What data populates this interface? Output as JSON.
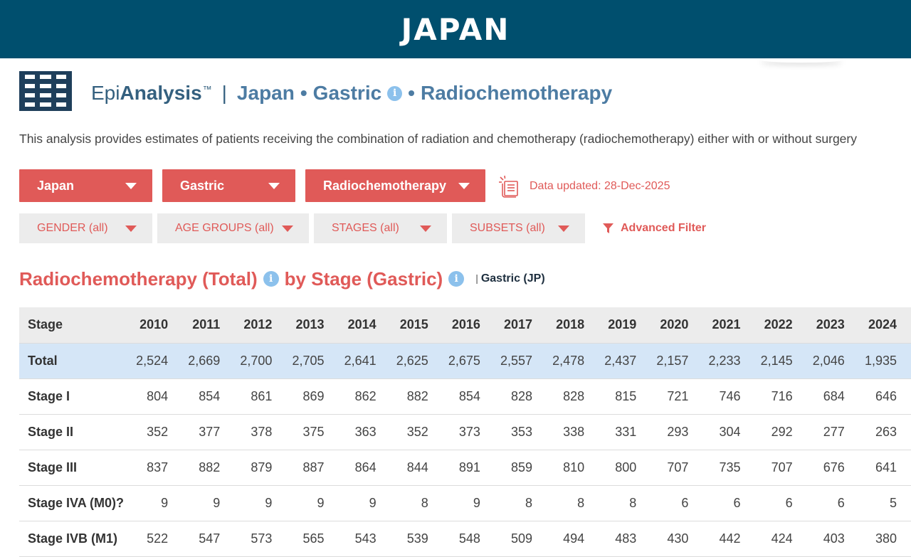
{
  "banner": {
    "title": "JAPAN"
  },
  "header": {
    "brand_light": "Epi",
    "brand_bold": "Analysis",
    "trademark": "™",
    "pipe": "|",
    "crumb_country": "Japan",
    "crumb_cancer": "Gastric",
    "crumb_treatment": "Radiochemotherapy",
    "separator": "•",
    "info_glyph": "i"
  },
  "description": "This analysis provides estimates of patients receiving the combination of radiation and chemotherapy (radiochemotherapy) either with or without surgery",
  "selectors": [
    {
      "label": "Japan"
    },
    {
      "label": "Gastric"
    },
    {
      "label": "Radiochemotherapy"
    }
  ],
  "data_updated": "Data updated: 28-Dec-2025",
  "filters": [
    {
      "label": "GENDER (all)"
    },
    {
      "label": "AGE GROUPS (all)"
    },
    {
      "label": "STAGES (all)"
    },
    {
      "label": "SUBSETS (all)"
    }
  ],
  "advanced_filter": "Advanced Filter",
  "section": {
    "title_part1": "Radiochemotherapy (Total)",
    "title_part2": "by Stage (Gastric)",
    "bar": "|",
    "subtitle": "Gastric (JP)"
  },
  "table": {
    "header_stage": "Stage",
    "years": [
      "2010",
      "2011",
      "2012",
      "2013",
      "2014",
      "2015",
      "2016",
      "2017",
      "2018",
      "2019",
      "2020",
      "2021",
      "2022",
      "2023",
      "2024"
    ],
    "rows": [
      {
        "stage": "Total",
        "values": [
          "2,524",
          "2,669",
          "2,700",
          "2,705",
          "2,641",
          "2,625",
          "2,675",
          "2,557",
          "2,478",
          "2,437",
          "2,157",
          "2,233",
          "2,145",
          "2,046",
          "1,935"
        ]
      },
      {
        "stage": "Stage I",
        "values": [
          "804",
          "854",
          "861",
          "869",
          "862",
          "882",
          "854",
          "828",
          "828",
          "815",
          "721",
          "746",
          "716",
          "684",
          "646"
        ]
      },
      {
        "stage": "Stage II",
        "values": [
          "352",
          "377",
          "378",
          "375",
          "363",
          "352",
          "373",
          "353",
          "338",
          "331",
          "293",
          "304",
          "292",
          "277",
          "263"
        ]
      },
      {
        "stage": "Stage III",
        "values": [
          "837",
          "882",
          "879",
          "887",
          "864",
          "844",
          "891",
          "859",
          "810",
          "800",
          "707",
          "735",
          "707",
          "676",
          "641"
        ]
      },
      {
        "stage": "Stage IVA (M0)?",
        "values": [
          "9",
          "9",
          "9",
          "9",
          "9",
          "8",
          "9",
          "8",
          "8",
          "8",
          "6",
          "6",
          "6",
          "6",
          "5"
        ]
      },
      {
        "stage": "Stage IVB (M1)",
        "values": [
          "522",
          "547",
          "573",
          "565",
          "543",
          "539",
          "548",
          "509",
          "494",
          "483",
          "430",
          "442",
          "424",
          "403",
          "380"
        ]
      }
    ]
  },
  "colors": {
    "banner_bg": "#004f6e",
    "accent_red": "#e05a58",
    "title_blue": "#34607f",
    "info_blue": "#8cc1ec",
    "total_row_bg": "#d5e6f7",
    "filter_bg": "#ececec"
  },
  "icons": {
    "logo": "table-grid-icon",
    "info": "info-icon",
    "caret": "caret-down-icon",
    "updated": "document-updated-icon",
    "filter": "funnel-icon"
  }
}
